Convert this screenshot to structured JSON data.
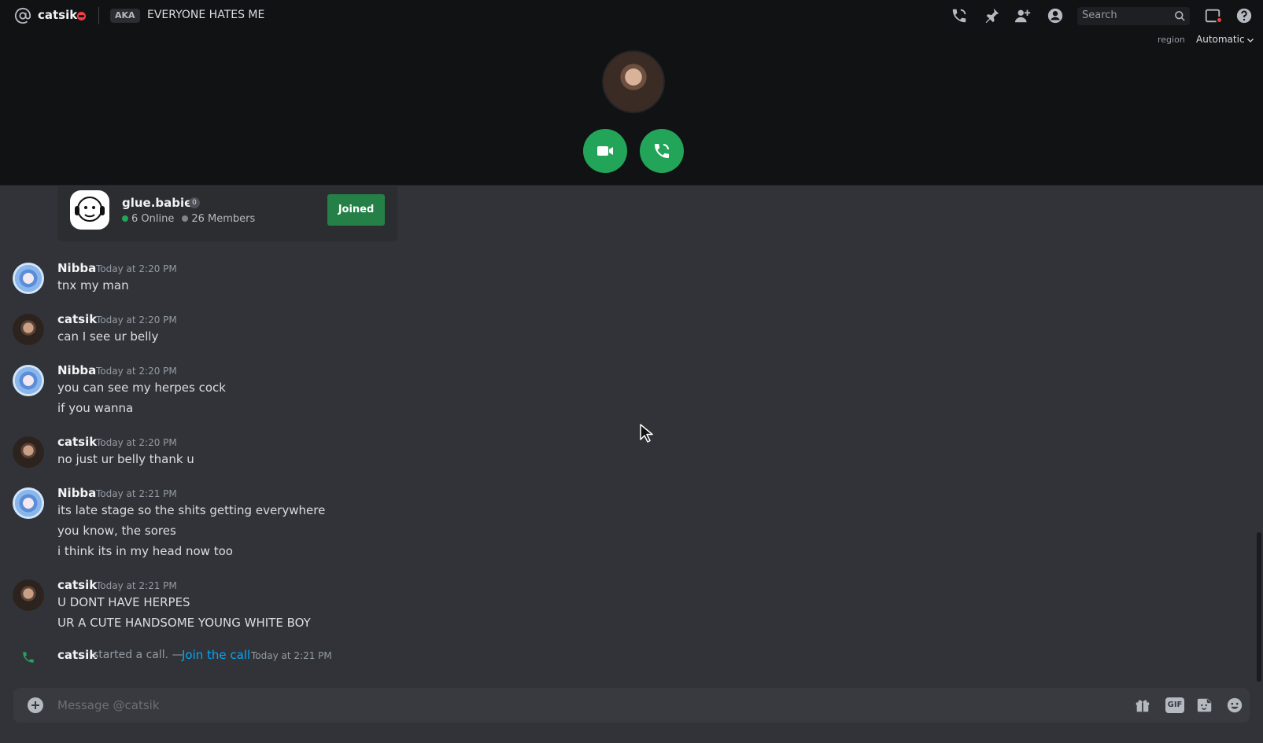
{
  "header": {
    "dm_name": "catsik",
    "aka_badge": "AKA",
    "aka_text": "EVERYONE HATES ME",
    "search_placeholder": "Search"
  },
  "region": {
    "label": "region",
    "value": "Automatic"
  },
  "invite": {
    "server_name": "glue.babies",
    "badge": "0",
    "online": "6 Online",
    "members": "26 Members",
    "joined_label": "Joined"
  },
  "messages": [
    {
      "author": "Nibba",
      "avatar": "nibba",
      "time": "Today at 2:20 PM",
      "lines": [
        "tnx my man"
      ]
    },
    {
      "author": "catsik",
      "avatar": "catsik",
      "time": "Today at 2:20 PM",
      "lines": [
        "can I see ur belly"
      ]
    },
    {
      "author": "Nibba",
      "avatar": "nibba",
      "time": "Today at 2:20 PM",
      "lines": [
        "you can see my herpes cock",
        "if you wanna"
      ]
    },
    {
      "author": "catsik",
      "avatar": "catsik",
      "time": "Today at 2:20 PM",
      "lines": [
        "no just ur belly thank u"
      ]
    },
    {
      "author": "Nibba",
      "avatar": "nibba",
      "time": "Today at 2:21 PM",
      "lines": [
        "its late stage so the shits getting everywhere",
        "you know, the sores",
        "i think its in my head now too"
      ]
    },
    {
      "author": "catsik",
      "avatar": "catsik",
      "time": "Today at 2:21 PM",
      "lines": [
        "U DONT HAVE HERPES",
        "UR A CUTE HANDSOME YOUNG WHITE BOY"
      ]
    }
  ],
  "system": {
    "author": "catsik",
    "text": "started a call. —",
    "link": "Join the call",
    "time": "Today at 2:21 PM"
  },
  "composer": {
    "placeholder": "Message @catsik",
    "gif_label": "GIF"
  },
  "colors": {
    "accent_green": "#23a559",
    "link_blue": "#00a8fc",
    "dnd_red": "#f23f43"
  }
}
